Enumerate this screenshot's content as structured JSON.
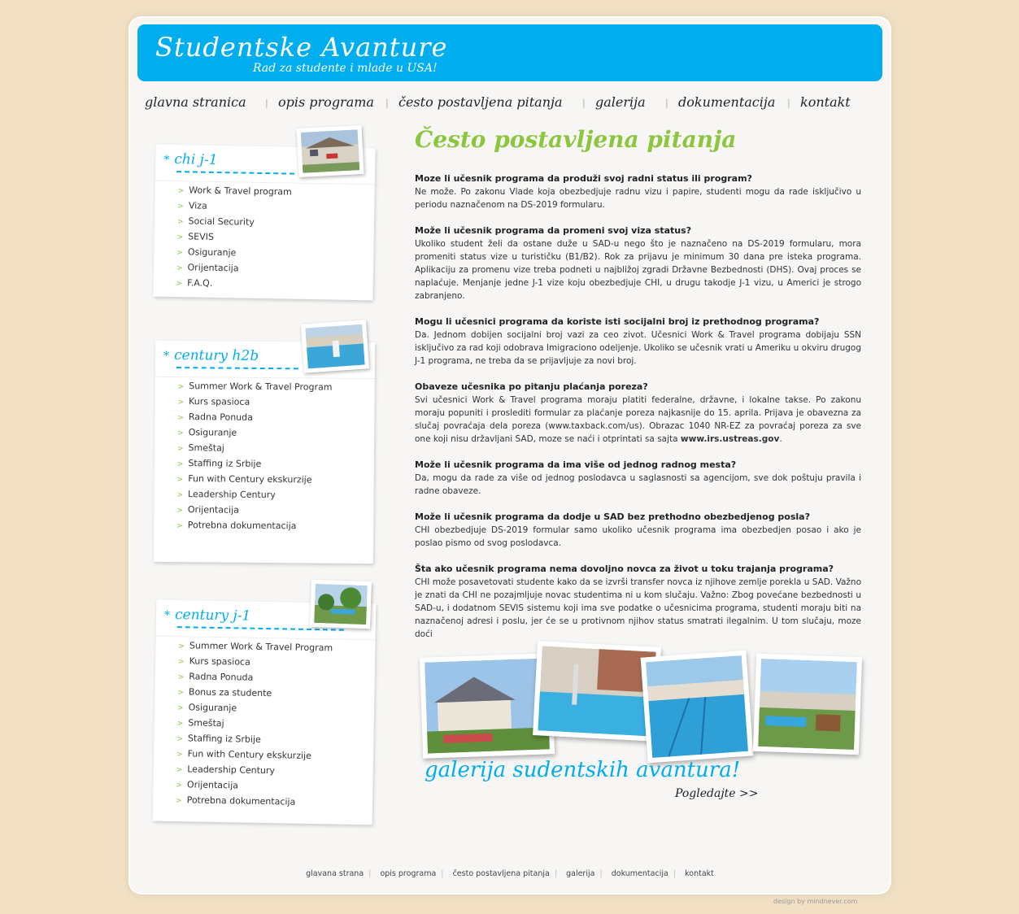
{
  "header": {
    "title": "Studentske Avanture",
    "tagline": "Rad za studente i mlade u USA!"
  },
  "nav": {
    "items": [
      "glavna stranica",
      "opis programa",
      "često postavljena pitanja",
      "galerija",
      "dokumentacija",
      "kontakt"
    ]
  },
  "sidebar": {
    "boxes": [
      {
        "title": "chi j-1",
        "items": [
          "Work & Travel program",
          "Viza",
          "Social Security",
          "SEVIS",
          "Osiguranje",
          "Orijentacija",
          "F.A.Q."
        ]
      },
      {
        "title": "century h2b",
        "items": [
          "Summer Work & Travel Program",
          "Kurs spasioca",
          "Radna Ponuda",
          "Osiguranje",
          "Smeštaj",
          "Staffing iz Srbije",
          "Fun with Century ekskurzije",
          "Leadership Century",
          "Orijentacija",
          "Potrebna dokumentacija"
        ]
      },
      {
        "title": "century j-1",
        "items": [
          "Summer Work & Travel Program",
          "Kurs spasioca",
          "Radna Ponuda",
          "Bonus za studente",
          "Osiguranje",
          "Smeštaj",
          "Staffing iz Srbije",
          "Fun with Century ekskurzije",
          "Leadership Century",
          "Orijentacija",
          "Potrebna dokumentacija"
        ]
      }
    ]
  },
  "main": {
    "title": "Često postavljena pitanja",
    "faq": [
      {
        "q": "Moze li učesnik programa da produži svoj radni status ili program?",
        "a": "Ne može. Po zakonu Vlade koja obezbedjuje radnu vizu i papire, studenti mogu da rade isključivo u periodu naznačenom na DS-2019 formularu."
      },
      {
        "q": "Može li učesnik programa da promeni svoj viza status?",
        "a": "Ukoliko student želi da ostane duže u SAD-u nego što je naznačeno na DS-2019 formularu, mora promeniti status vize u turističku (B1/B2). Rok za prijavu je minimum 30 dana pre isteka programa. Aplikaciju za promenu vize treba podneti u najbližoj zgradi Državne Bezbednosti (DHS). Ovaj proces se naplaćuje. Menjanje jedne J-1 vize koju obezbedjuje CHI, u drugu takodje J-1 vizu, u Americi je strogo zabranjeno."
      },
      {
        "q": "Mogu li učesnici programa da koriste isti socijalni broj iz prethodnog programa?",
        "a": "Da. Jednom dobijen socijalni broj vazi za ceo zivot. Učesnici Work & Travel programa dobijaju SSN isključivo za rad koji odobrava Imigraciono odeljenje. Ukoliko se učesnik vrati u Ameriku u okviru drugog J-1 programa, ne treba da se prijavljuje za novi broj."
      },
      {
        "q": "Obaveze učesnika po pitanju plaćanja poreza?",
        "a": "Svi učesnici Work & Travel programa moraju platiti federalne, državne, i lokalne takse. Po zakonu moraju popuniti i proslediti formular za plaćanje poreza najkasnije do 15. aprila. Prijava je obavezna za slučaj povraćaja dela poreza (www.taxback.com/us). Obrazac 1040 NR-EZ za povraćaj poreza za sve one koji nisu državljani SAD, moze se naći i otprintati sa sajta",
        "link": "www.irs.ustreas.gov",
        "tail": "."
      },
      {
        "q": "Može li učesnik programa da ima više od jednog radnog mesta?",
        "a": "Da, mogu da rade za više od jednog poslodavca u saglasnosti sa agencijom, sve dok poštuju pravila i radne obaveze."
      },
      {
        "q": "Može li učesnik programa da dodje u SAD bez prethodno obezbedjenog posla?",
        "a": "CHI obezbedjuje DS-2019 formular samo ukoliko učesnik programa ima obezbedjen posao i ako je poslao pismo od svog poslodavca."
      },
      {
        "q": "Šta ako učesnik programa nema dovoljno novca za život u toku trajanja programa?",
        "a": "CHI može posavetovati studente kako da se izvrši transfer novca iz njihove zemlje porekla u SAD. Važno je znati da CHI ne pozajmljuje novac studentima ni u kom slučaju. Važno: Zbog povećane bezbednosti u SAD-u, i dodatnom SEVIS sistemu koji ima sve podatke o učesnicima programa, studenti moraju biti na naznačenoj adresi i poslu, jer će se u protivnom njihov status smatrati ilegalnim. U tom slučaju, moze doći"
      }
    ]
  },
  "gallery": {
    "caption": "galerija sudentskih avantura!",
    "cta": "Pogledajte >>"
  },
  "footer": {
    "links": [
      "glavana strana",
      "opis programa",
      "često postavljena pitanja",
      "galerija",
      "dokumentacija",
      "kontakt"
    ]
  },
  "credit": "design by  mindnever.com",
  "colors": {
    "accent_blue": "#00adef",
    "accent_green": "#8cc63f",
    "background": "#f1e0c4"
  }
}
